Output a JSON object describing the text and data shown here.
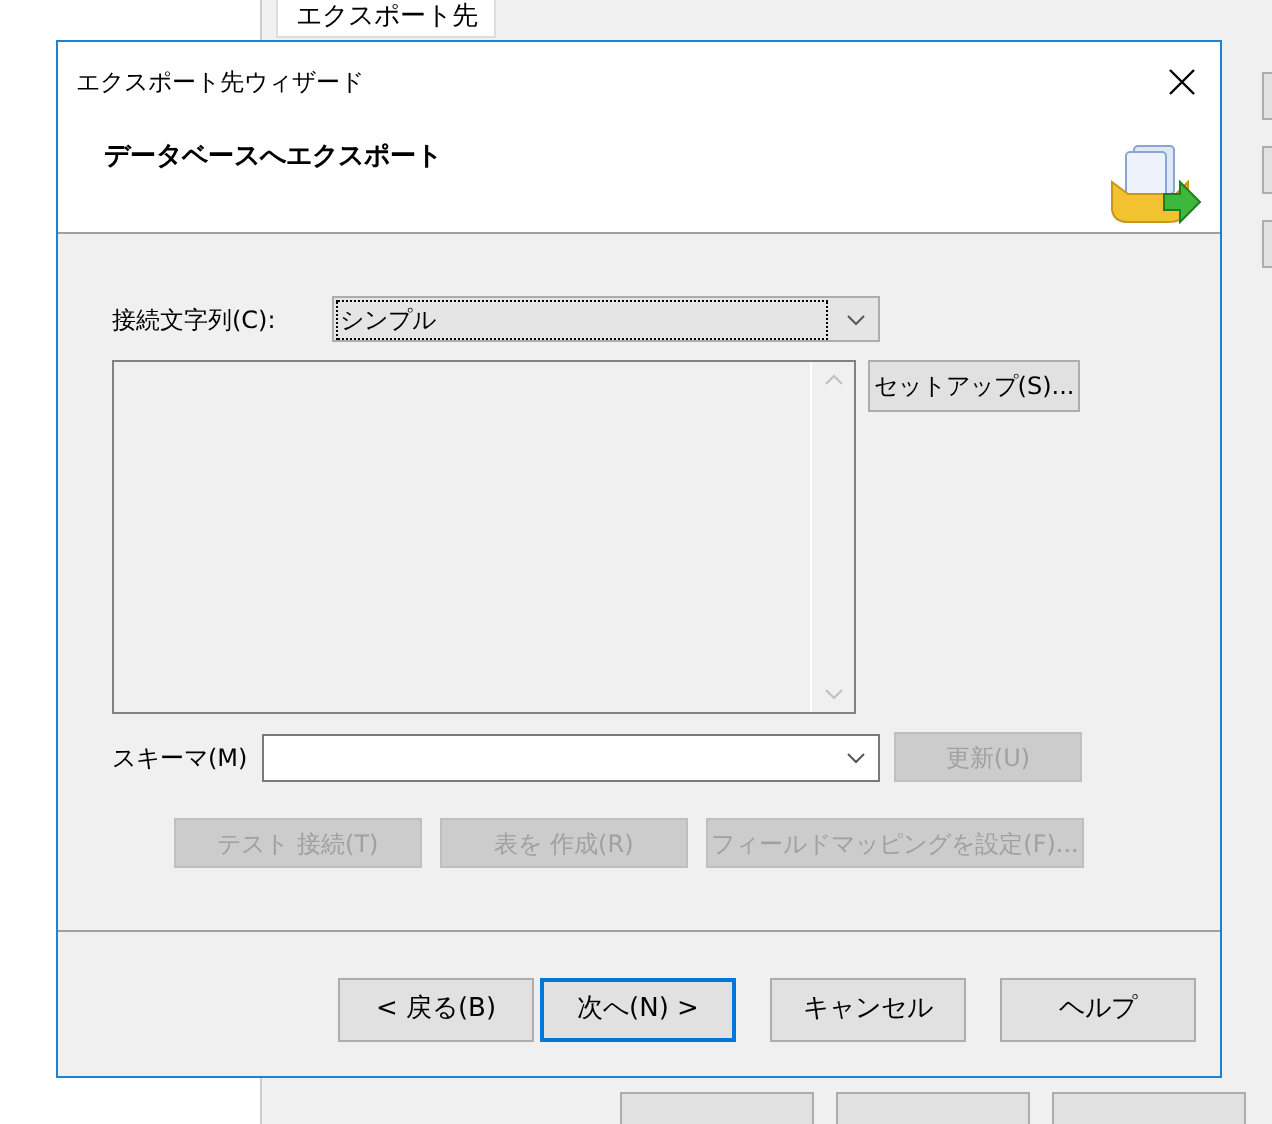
{
  "background_window": {
    "tab": {
      "label": "エクスポート先",
      "selected": true
    }
  },
  "dialog": {
    "title": "エクスポート先ウィザード",
    "heading": "データベースへエクスポート",
    "connection_label": "接続文字列(C):",
    "connection_value": "シンプル",
    "setup_button": {
      "label": "セットアップ(S)...",
      "disabled": false
    },
    "schema_label": "スキーマ(M)",
    "refresh_button": {
      "label": "更新(U)",
      "disabled": true
    },
    "action_buttons": [
      {
        "label": "テスト 接続(T)",
        "disabled": true
      },
      {
        "label": "表を 作成(R)",
        "disabled": true
      },
      {
        "label": "フィールドマッピングを設定(F)...",
        "disabled": true
      }
    ],
    "nav_buttons": [
      {
        "label": "< 戻る(B)",
        "focused": false
      },
      {
        "label": "次へ(N) >",
        "focused": true
      },
      {
        "label": "キャンセル",
        "focused": false
      },
      {
        "label": "ヘルプ",
        "focused": false
      }
    ]
  }
}
